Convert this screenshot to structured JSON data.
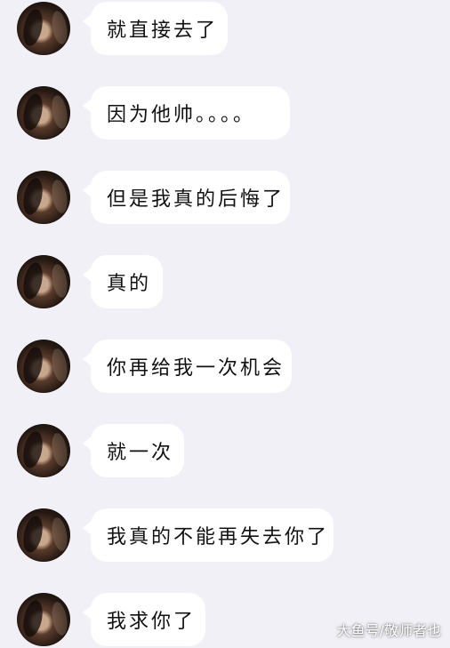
{
  "messages": [
    {
      "text": "就直接去了"
    },
    {
      "text": "因为他帅。。。。"
    },
    {
      "text": "但是我真的后悔了"
    },
    {
      "text": "真的"
    },
    {
      "text": "你再给我一次机会"
    },
    {
      "text": "就一次"
    },
    {
      "text": "我真的不能再失去你了"
    },
    {
      "text": "我求你了"
    }
  ],
  "watermark": "大鱼号/敬师者也",
  "colors": {
    "background": "#f0f0f6",
    "bubble": "#ffffff",
    "text": "#111111"
  }
}
